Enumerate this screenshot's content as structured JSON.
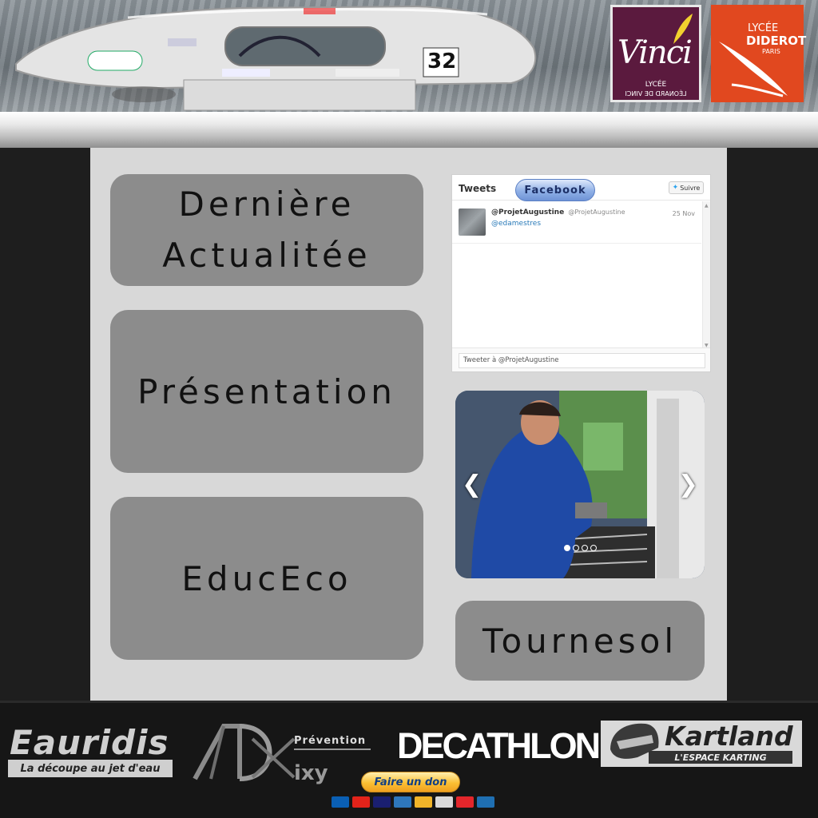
{
  "header": {
    "car_number": "32",
    "logo_vinci": {
      "script": "Vinci",
      "line1": "LYCÉE",
      "line2": "LÉONARD DE VINCI"
    },
    "logo_diderot": {
      "line1": "LYCÉE",
      "line2": "DIDEROT",
      "line3": "PARIS"
    }
  },
  "tiles": {
    "news_line1": "Dernière",
    "news_line2": "Actualitée",
    "presentation": "Présentation",
    "educeco": "EducEco",
    "tournesol": "Tournesol"
  },
  "twitter": {
    "title": "Tweets",
    "facebook_label": "Facebook",
    "follow_label": "Suivre",
    "tweet": {
      "user": "@ProjetAugustine",
      "handle": "@ProjetAugustine",
      "date": "25 Nov",
      "body": "@edamestres"
    },
    "compose_placeholder": "Tweeter à @ProjetAugustine"
  },
  "slider": {
    "prev_glyph": "❮",
    "next_glyph": "❯",
    "slide_count": 4,
    "active_index": 0
  },
  "footer": {
    "eauridis_name": "Eauridis",
    "eauridis_tagline": "La découpe au jet d'eau",
    "adv_prevention": "Prévention",
    "adv_name": "ixy",
    "decathlon": "DECATHLON",
    "kartland_name": "Kartland",
    "kartland_tagline": "L'ESPACE KARTING",
    "donate_label": "Faire un don",
    "cards": [
      "Maestro",
      "MasterCard",
      "VISA",
      "Amex",
      "Aurore",
      "Cofinoga",
      "4étoiles",
      "CB"
    ]
  },
  "colors": {
    "tile_bg": "#8c8c8c",
    "panel_bg": "#d8d8d8",
    "page_bg": "#1e1e1e",
    "vinci": "#5b1a3e",
    "diderot": "#e1481f",
    "donate": "#fbbf33"
  }
}
